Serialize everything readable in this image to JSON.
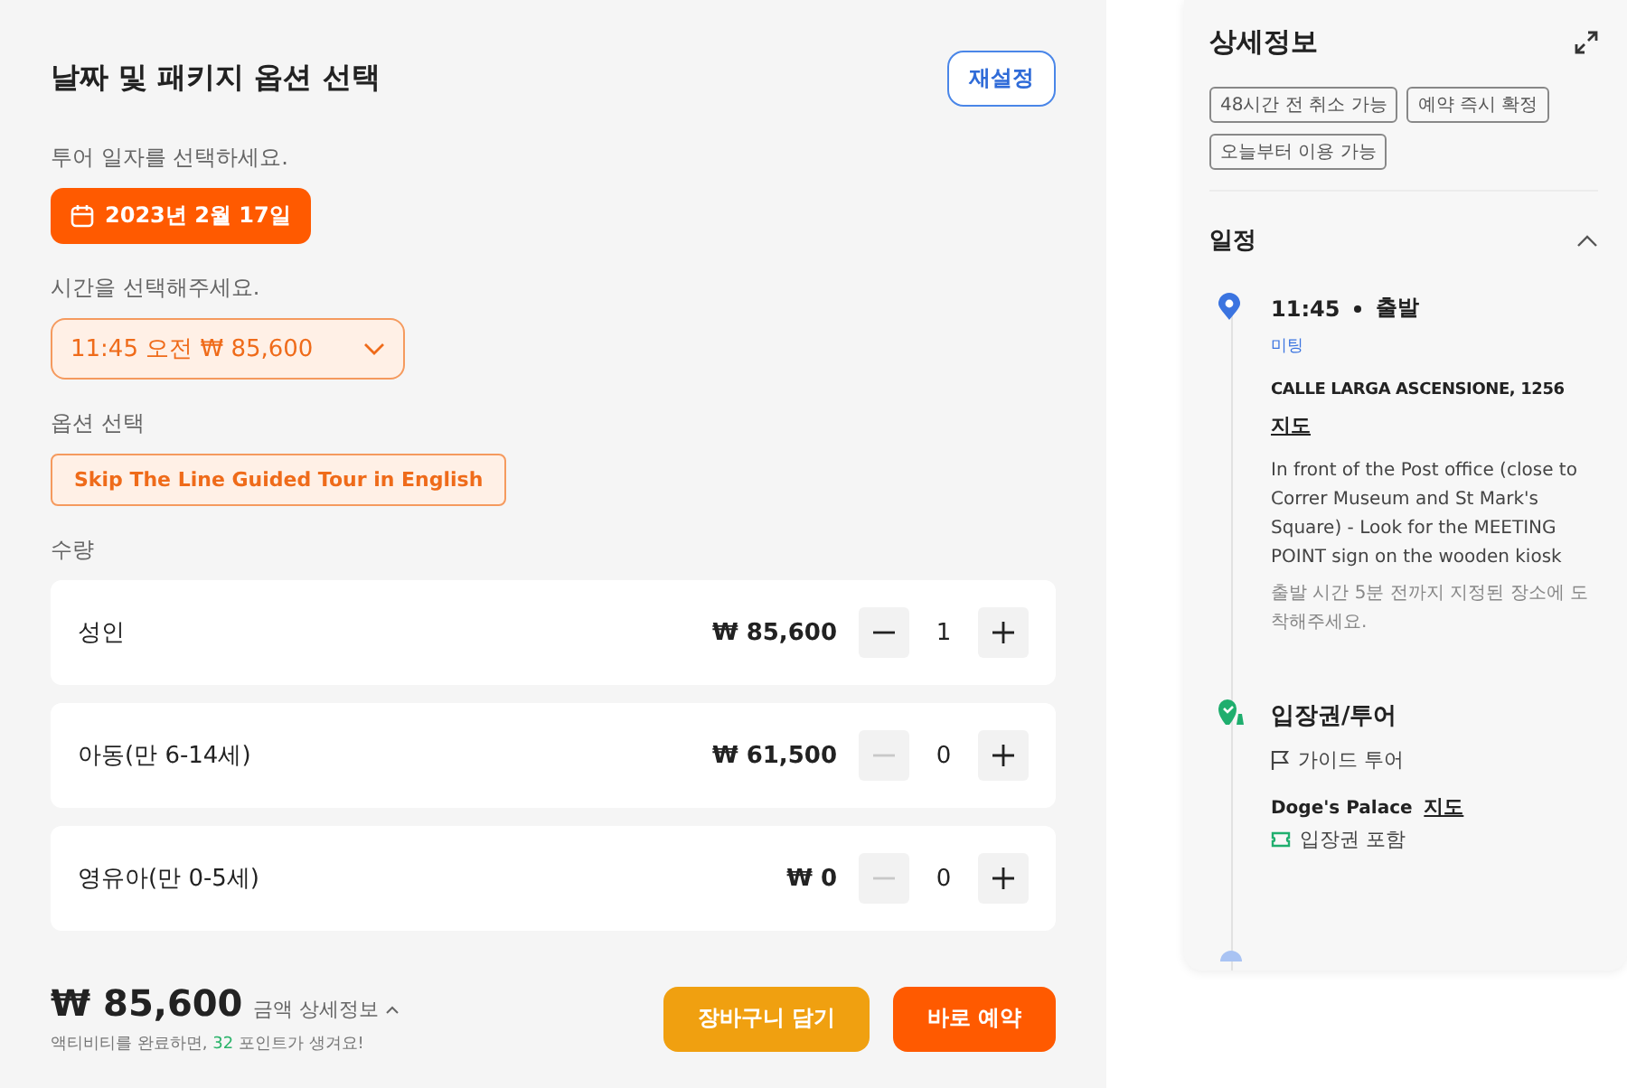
{
  "booking": {
    "title": "날짜 및 패키지 옵션 선택",
    "reset_button": "재설정",
    "date_label": "투어 일자를 선택하세요.",
    "date": "2023년 2월 17일",
    "time_label": "시간을 선택해주세요.",
    "time_value": "11:45 오전 ₩ 85,600",
    "option_label": "옵션 선택",
    "options": [
      {
        "label": "Skip The Line Guided Tour in English",
        "selected": true
      }
    ],
    "quantity_label": "수량",
    "quantities": [
      {
        "name": "성인",
        "price": "₩ 85,600",
        "count": "1",
        "minus_disabled": false
      },
      {
        "name": "아동(만 6-14세)",
        "price": "₩ 61,500",
        "count": "0",
        "minus_disabled": true
      },
      {
        "name": "영유아(만 0-5세)",
        "price": "₩ 0",
        "count": "0",
        "minus_disabled": true
      }
    ],
    "total": "₩ 85,600",
    "total_details": "금액 상세정보",
    "points_before": "액티비티를 완료하면, ",
    "points": "32",
    "points_after": " 포인트가 생겨요!",
    "buttons": [
      {
        "label": "장바구니 담기",
        "kind": "cart"
      },
      {
        "label": "바로 예약",
        "kind": "book"
      }
    ]
  },
  "details": {
    "title": "상세정보",
    "tags": [
      "48시간 전 취소 가능",
      "예약 즉시 확정",
      "오늘부터 이용 가능"
    ],
    "itinerary": {
      "title": "일정",
      "expanded": true,
      "stops": [
        {
          "kind": "start",
          "time": "11:45",
          "title": "출발",
          "badge": "미팅",
          "address": "CALLE LARGA ASCENSIONE, 1256",
          "map_link": "지도",
          "description": "In front of the Post office (close to Correr Museum and St Mark's Square) - Look for the MEETING POINT sign on the wooden kiosk",
          "note": "출발 시간 5분 전까지 지정된 장소에 도착해주세요."
        },
        {
          "kind": "entry",
          "title": "입장권/투어",
          "subtitle": "가이드 투어",
          "place": "Doge's Palace",
          "map_link": "지도",
          "ticket": "입장권 포함"
        }
      ]
    }
  }
}
